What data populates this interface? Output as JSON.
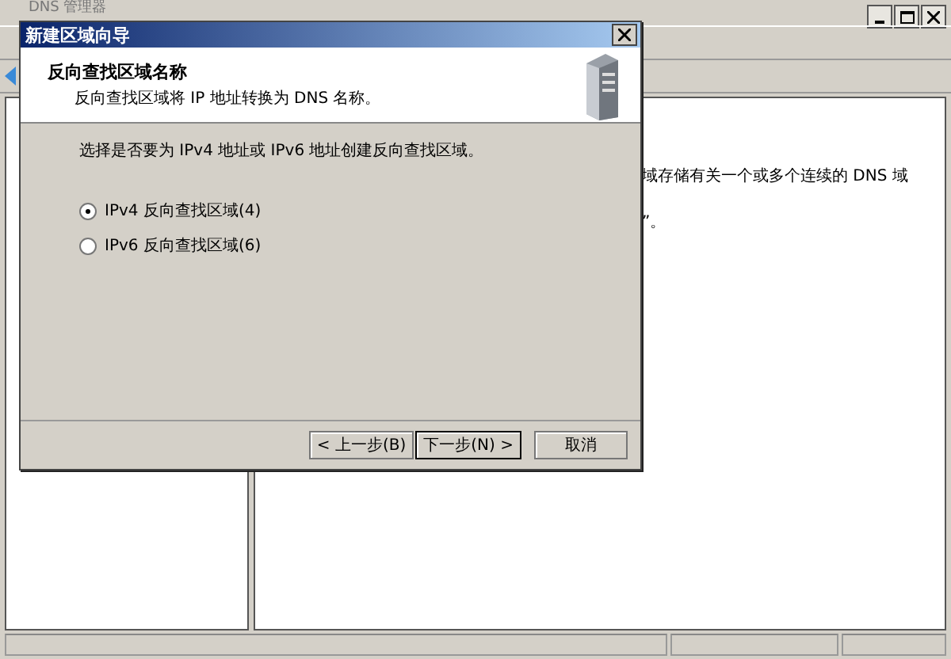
{
  "main_window": {
    "title": "DNS 管理器",
    "details_lines": [
      "域存储有关一个或多个连续的 DNS 域",
      "”。"
    ]
  },
  "dialog": {
    "title": "新建区域向导",
    "heading": "反向查找区域名称",
    "subheading": "反向查找区域将 IP 地址转换为 DNS 名称。",
    "question": "选择是否要为 IPv4 地址或 IPv6 地址创建反向查找区域。",
    "options": [
      {
        "label": "IPv4 反向查找区域(4)",
        "selected": true
      },
      {
        "label": "IPv6 反向查找区域(6)",
        "selected": false
      }
    ],
    "buttons": [
      {
        "label": "< 上一步(B)",
        "default": false
      },
      {
        "label": "下一步(N) >",
        "default": true
      },
      {
        "label": "取消",
        "default": false
      }
    ]
  }
}
